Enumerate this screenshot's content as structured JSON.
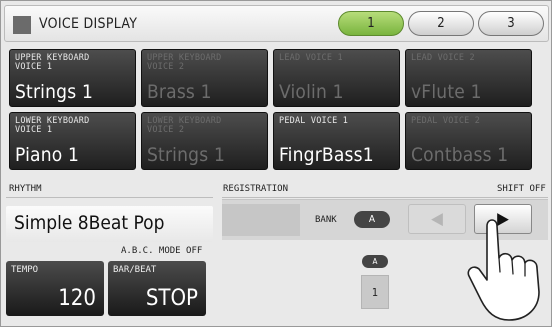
{
  "header": {
    "title": "VOICE DISPLAY",
    "page_tabs": [
      {
        "label": "1",
        "active": true
      },
      {
        "label": "2",
        "active": false
      },
      {
        "label": "3",
        "active": false
      }
    ]
  },
  "voices": [
    {
      "category": "UPPER KEYBOARD\nVOICE 1",
      "name": "Strings 1",
      "enabled": true
    },
    {
      "category": "UPPER KEYBOARD\nVOICE 2",
      "name": "Brass 1",
      "enabled": false
    },
    {
      "category": "LEAD VOICE 1",
      "name": "Violin 1",
      "enabled": false
    },
    {
      "category": "LEAD VOICE 2",
      "name": "vFlute 1",
      "enabled": false
    },
    {
      "category": "LOWER KEYBOARD\nVOICE 1",
      "name": "Piano 1",
      "enabled": true
    },
    {
      "category": "LOWER KEYBOARD\nVOICE 2",
      "name": "Strings 1",
      "enabled": false
    },
    {
      "category": "PEDAL VOICE 1",
      "name": "FingrBass1",
      "enabled": true
    },
    {
      "category": "PEDAL VOICE 2",
      "name": "Contbass 1",
      "enabled": false
    }
  ],
  "rhythm": {
    "label": "RHYTHM",
    "name": "Simple 8Beat Pop",
    "abc_mode": "A.B.C. MODE OFF",
    "tempo_label": "TEMPO",
    "tempo_value": "120",
    "barbeat_label": "BAR/BEAT",
    "barbeat_value": "STOP"
  },
  "registration": {
    "label": "REGISTRATION",
    "shift": "SHIFT OFF",
    "bank_label": "BANK",
    "bank_value": "A",
    "memory_bank": "A",
    "memory_number": "1",
    "prev_icon": "left-triangle-icon",
    "next_icon": "right-triangle-icon"
  },
  "colors": {
    "active_tab": "#8fc64d",
    "voice_bg": "#2e2e2e"
  }
}
